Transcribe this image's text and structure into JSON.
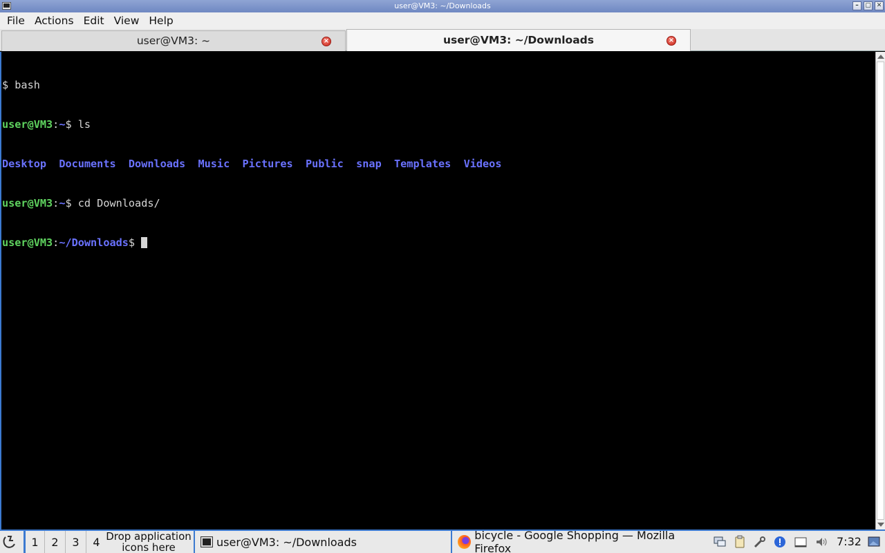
{
  "window": {
    "title": "user@VM3: ~/Downloads"
  },
  "menu": [
    "File",
    "Actions",
    "Edit",
    "View",
    "Help"
  ],
  "tabs": [
    {
      "label": "user@VM3: ~",
      "active": false
    },
    {
      "label": "user@VM3: ~/Downloads",
      "active": true
    }
  ],
  "terminal": {
    "line1": "$ bash",
    "line2": {
      "user": "user@VM3",
      "path": "~",
      "suffix": "$ ls"
    },
    "ls_output": [
      "Desktop",
      "Documents",
      "Downloads",
      "Music",
      "Pictures",
      "Public",
      "snap",
      "Templates",
      "Videos"
    ],
    "line4": {
      "user": "user@VM3",
      "path": "~",
      "suffix": "$ cd Downloads/"
    },
    "line5": {
      "user": "user@VM3",
      "path": "~/Downloads",
      "suffix": "$ "
    }
  },
  "taskbar": {
    "workspaces": [
      "1",
      "2",
      "3",
      "4"
    ],
    "drop_line1": "Drop application",
    "drop_line2": "icons here",
    "task_terminal": "user@VM3: ~/Downloads",
    "task_firefox": "bicycle - Google Shopping — Mozilla Firefox",
    "clock": "7:32"
  },
  "colors": {
    "accent": "#3c7ad0",
    "prompt_user": "#5fd35f",
    "prompt_path": "#6a72ff"
  }
}
